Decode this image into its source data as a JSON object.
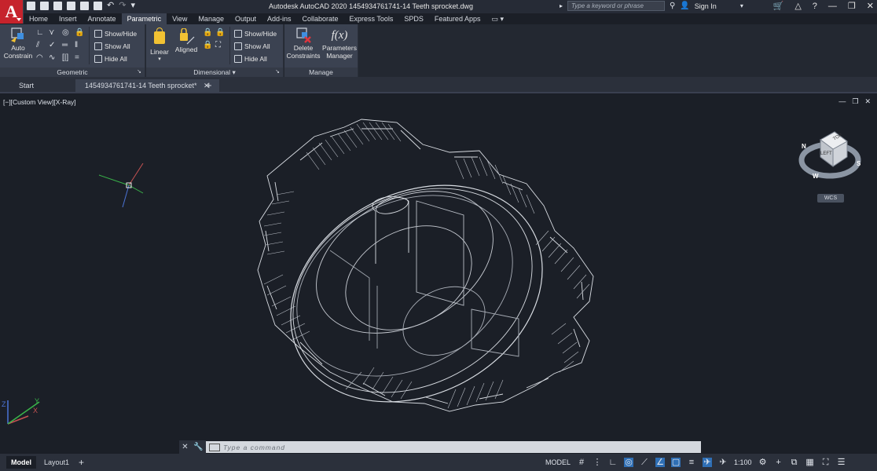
{
  "app": {
    "logo_letter": "A",
    "title": "Autodesk AutoCAD 2020   1454934761741-14 Teeth sprocket.dwg",
    "search_placeholder": "Type a keyword or phrase",
    "signin": "Sign In"
  },
  "ribbon_tabs": [
    "Home",
    "Insert",
    "Annotate",
    "Parametric",
    "View",
    "Manage",
    "Output",
    "Add-ins",
    "Collaborate",
    "Express Tools",
    "SPDS",
    "Featured Apps"
  ],
  "active_tab": "Parametric",
  "panels": {
    "geometric": {
      "title": "Geometric",
      "auto_constrain_line1": "Auto",
      "auto_constrain_line2": "Constrain",
      "show_hide": "Show/Hide",
      "show_all": "Show All",
      "hide_all": "Hide All"
    },
    "dimensional": {
      "title": "Dimensional",
      "linear": "Linear",
      "aligned": "Aligned",
      "show_hide": "Show/Hide",
      "show_all": "Show All",
      "hide_all": "Hide All"
    },
    "manage": {
      "title": "Manage",
      "delete_line1": "Delete",
      "delete_line2": "Constraints",
      "params_line1": "Parameters",
      "params_line2": "Manager",
      "fx": "f(x)"
    }
  },
  "file_tabs": [
    "Start",
    "1454934761741-14 Teeth sprocket*"
  ],
  "viewport": {
    "label": "[−][Custom View][X-Ray]",
    "viewcube_top": "TOP",
    "viewcube_left": "LEFT",
    "compass_n": "N",
    "compass_w": "W",
    "compass_s": "S",
    "wcs": "WCS"
  },
  "command": {
    "placeholder": "Type  a  command"
  },
  "layout_tabs": [
    "Model",
    "Layout1"
  ],
  "status": {
    "model": "MODEL",
    "scale": "1:100"
  },
  "colors": {
    "accent": "#2f6fb5",
    "logo": "#c6232c",
    "background": "#1b1f27"
  }
}
